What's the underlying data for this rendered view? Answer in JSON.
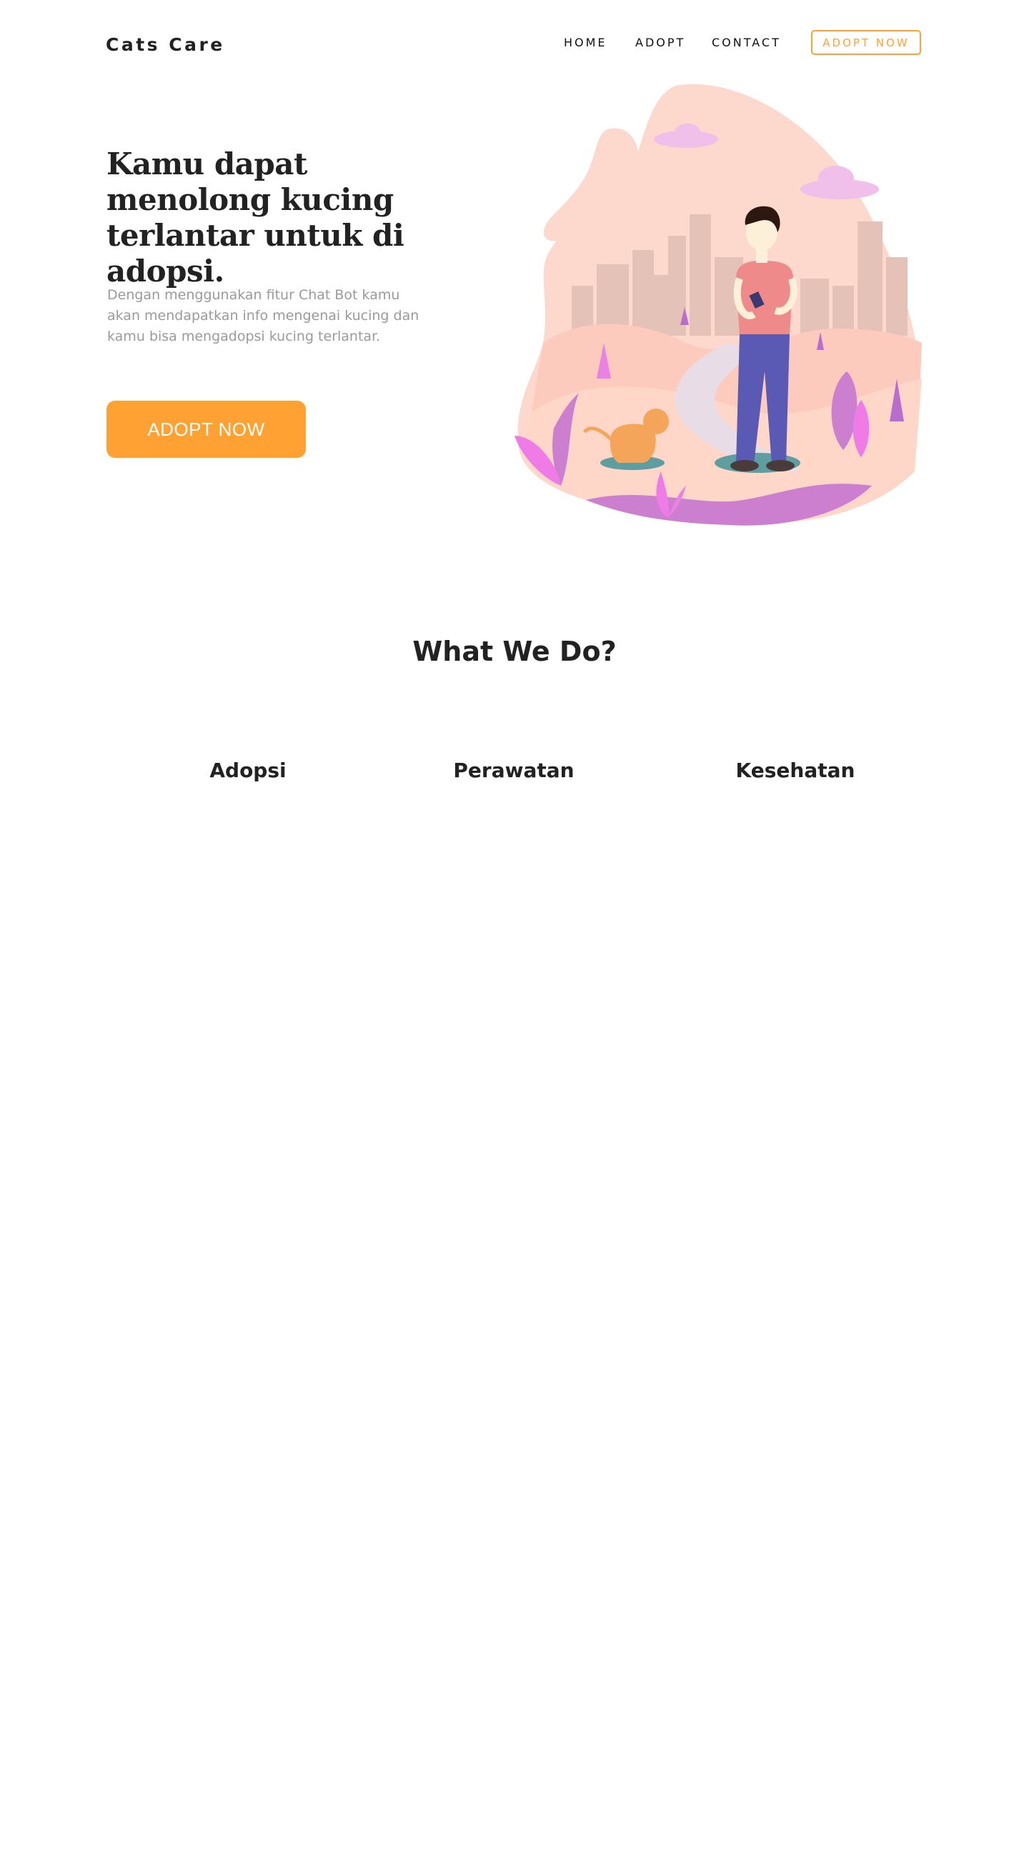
{
  "navbar": {
    "brand": "Cats Care",
    "links": [
      {
        "label": "HOME"
      },
      {
        "label": "ADOPT"
      },
      {
        "label": "CONTACT"
      }
    ],
    "cta_label": "ADOPT NOW"
  },
  "hero": {
    "title": "Kamu dapat menolong kucing terlantar untuk di adopsi.",
    "text": "Dengan menggunakan fitur Chat Bot kamu akan mendapatkan info mengenai kucing dan kamu bisa mengadopsi kucing terlantar.",
    "button_label": "ADOPT NOW"
  },
  "services": {
    "title": "What We Do?",
    "items": [
      {
        "label": "Adopsi"
      },
      {
        "label": "Perawatan"
      },
      {
        "label": "Kesehatan"
      }
    ]
  },
  "colors": {
    "accent": "#ffa233",
    "text_dark": "#222222",
    "text_muted": "#9a9a9a",
    "background": "#ffffff"
  }
}
